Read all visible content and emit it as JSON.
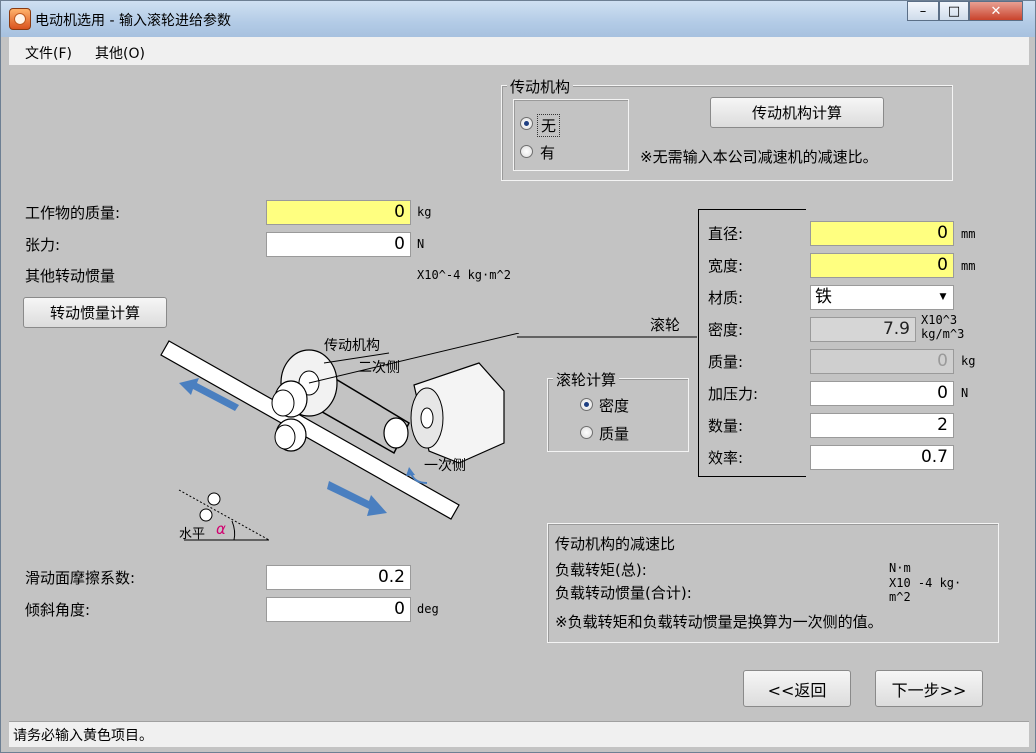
{
  "window": {
    "title": "电动机选用 - 输入滚轮进给参数",
    "minimize": "–",
    "maximize": "□",
    "close": "✕"
  },
  "menu": {
    "file": "文件(F)",
    "other": "其他(O)"
  },
  "transmission": {
    "group_title": "传动机构",
    "option_none": "无",
    "option_yes": "有",
    "calc_button": "传动机构计算",
    "note": "※无需输入本公司减速机的减速比。"
  },
  "workpiece": {
    "mass_label": "工作物的质量:",
    "mass_value": "0",
    "mass_unit": "kg",
    "tension_label": "张力:",
    "tension_value": "0",
    "tension_unit": "N",
    "other_inertia_label": "其他转动惯量",
    "other_inertia_unit": "X10^-4 kg·m^2",
    "inertia_button": "转动惯量计算"
  },
  "diagram": {
    "label_transmission": "传动机构",
    "label_secondary": "二次侧",
    "label_primary": "一次侧",
    "label_roller": "滚轮",
    "label_horizontal": "水平",
    "label_alpha": "α"
  },
  "roller": {
    "diameter_label": "直径:",
    "diameter_value": "0",
    "diameter_unit": "mm",
    "width_label": "宽度:",
    "width_value": "0",
    "width_unit": "mm",
    "material_label": "材质:",
    "material_value": "铁",
    "density_label": "密度:",
    "density_value": "7.9",
    "density_unit_1": "X10^3",
    "density_unit_2": "kg/m^3",
    "mass_label": "质量:",
    "mass_value": "0",
    "mass_unit": "kg",
    "pressure_label": "加压力:",
    "pressure_value": "0",
    "pressure_unit": "N",
    "count_label": "数量:",
    "count_value": "2",
    "efficiency_label": "效率:",
    "efficiency_value": "0.7"
  },
  "roller_calc": {
    "group_title": "滚轮计算",
    "option_density": "密度",
    "option_mass": "质量"
  },
  "friction": {
    "label": "滑动面摩擦系数:",
    "value": "0.2",
    "angle_label": "倾斜角度:",
    "angle_value": "0",
    "angle_unit": "deg"
  },
  "results": {
    "title": "传动机构的减速比",
    "load_torque_label": "负载转矩(总):",
    "load_torque_unit": "N·m",
    "load_inertia_label": "负载转动惯量(合计):",
    "load_inertia_unit_1": "X10 -4 kg·",
    "load_inertia_unit_2": "m^2",
    "note": "※负载转矩和负载转动惯量是换算为一次侧的值。"
  },
  "nav": {
    "back": "<<返回",
    "next": "下一步>>"
  },
  "status": "请务必输入黄色项目。",
  "colors": {
    "required": "#ffff80",
    "titlebar": "#b3cbe6",
    "face": "#c3c3c3"
  }
}
